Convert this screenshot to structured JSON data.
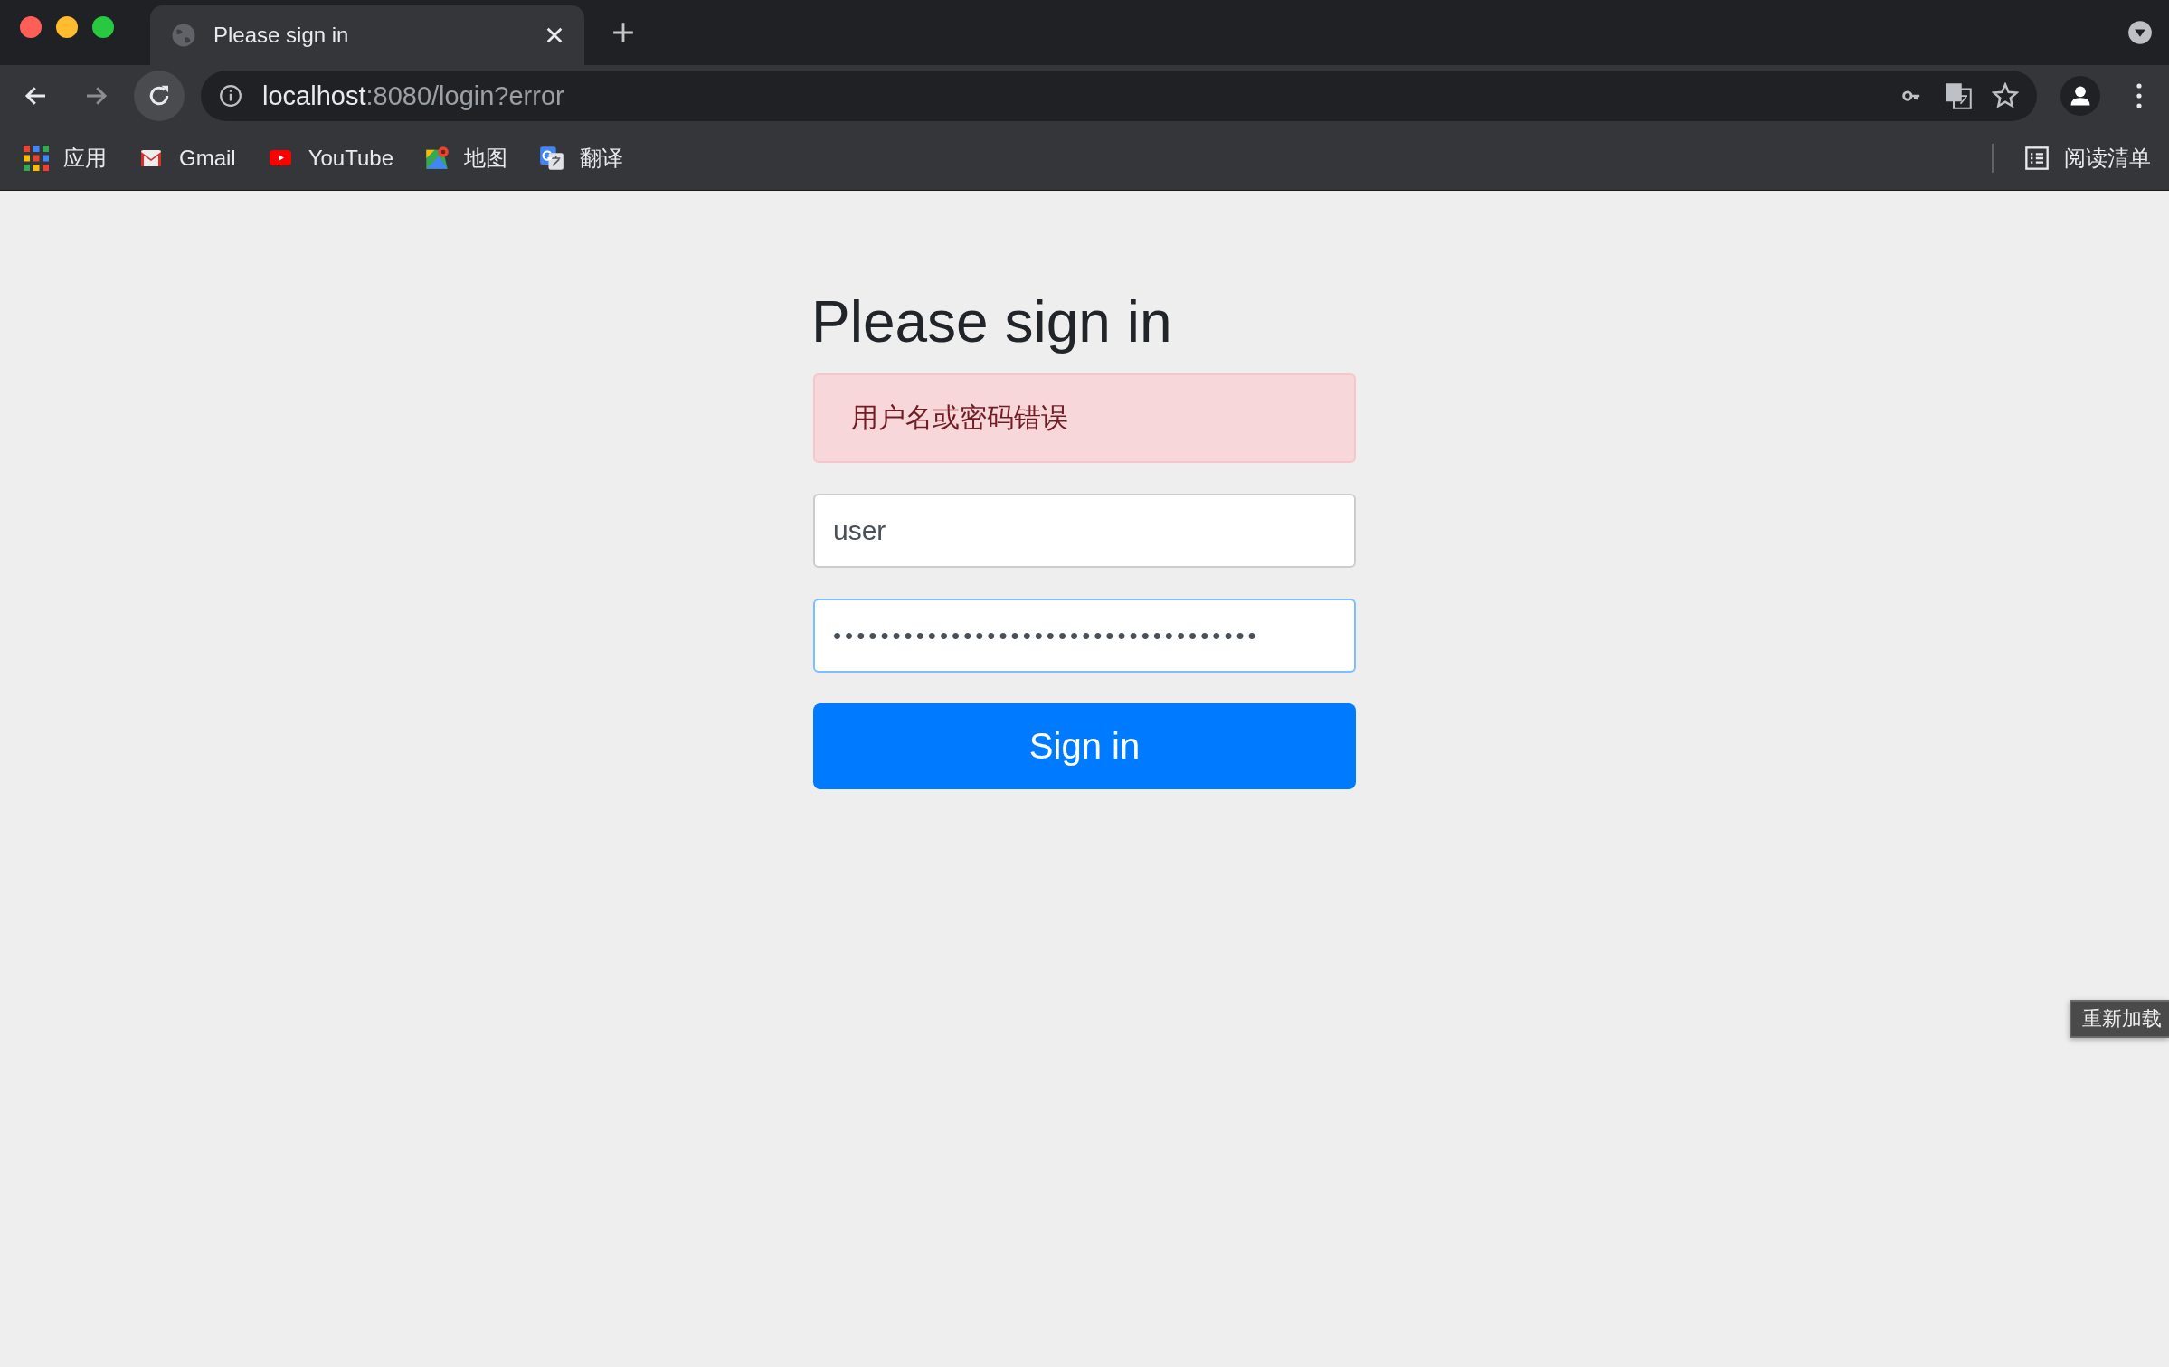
{
  "browser": {
    "tabs": [
      {
        "title": "Please sign in",
        "selected": true
      }
    ],
    "address": {
      "host": "localhost",
      "rest": ":8080/login?error"
    },
    "bookmarks": [
      {
        "label": "应用",
        "kind": "apps"
      },
      {
        "label": "Gmail",
        "kind": "gmail"
      },
      {
        "label": "YouTube",
        "kind": "youtube"
      },
      {
        "label": "地图",
        "kind": "maps"
      },
      {
        "label": "翻译",
        "kind": "translate"
      }
    ],
    "reading_list": "阅读清单"
  },
  "page": {
    "heading": "Please sign in",
    "error": "用户名或密码错误",
    "fields": [
      {
        "kind": "text",
        "value": "user",
        "focused": false
      },
      {
        "kind": "password",
        "value": "••••••••••••••••••••••••••••••••••••",
        "focused": true
      }
    ],
    "submit": "Sign in"
  },
  "tooltip": "重新加载"
}
